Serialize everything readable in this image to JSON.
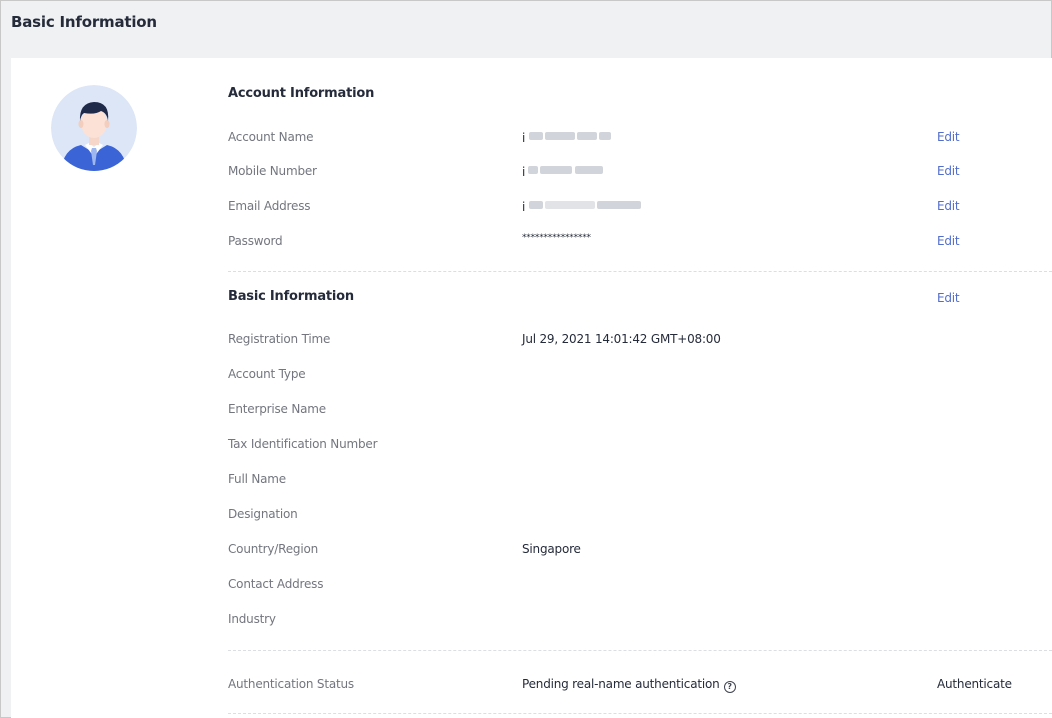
{
  "header": {
    "title": "Basic Information"
  },
  "account": {
    "title": "Account Information",
    "rows": [
      {
        "label": "Account Name",
        "value": "i",
        "action": "Edit"
      },
      {
        "label": "Mobile Number",
        "value": "i",
        "action": "Edit"
      },
      {
        "label": "Email Address",
        "value": "i",
        "action": "Edit"
      },
      {
        "label": "Password",
        "value": "****************",
        "action": "Edit"
      }
    ]
  },
  "basic": {
    "title": "Basic Information",
    "edit": "Edit",
    "rows": [
      {
        "label": "Registration Time",
        "value": "Jul 29, 2021 14:01:42 GMT+08:00"
      },
      {
        "label": "Account Type",
        "value": ""
      },
      {
        "label": "Enterprise Name",
        "value": ""
      },
      {
        "label": "Tax Identification Number",
        "value": ""
      },
      {
        "label": "Full Name",
        "value": ""
      },
      {
        "label": "Designation",
        "value": ""
      },
      {
        "label": "Country/Region",
        "value": "Singapore"
      },
      {
        "label": "Contact Address",
        "value": ""
      },
      {
        "label": "Industry",
        "value": ""
      }
    ]
  },
  "auth": {
    "label": "Authentication Status",
    "value": "Pending real-name authentication",
    "action": "Authenticate"
  },
  "icons": {
    "avatar": "user-avatar-icon",
    "help": "question-circle-icon"
  },
  "colors": {
    "link": "#526ecc",
    "header_bg": "#f0f1f3",
    "label": "#73767f"
  }
}
